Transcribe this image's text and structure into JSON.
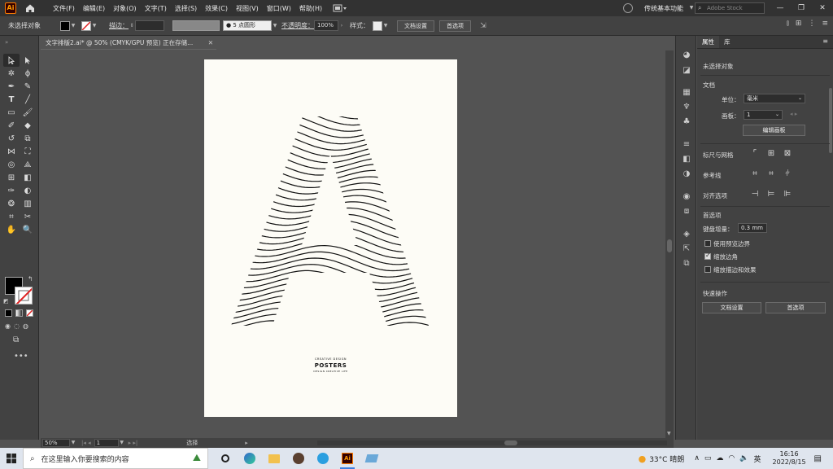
{
  "menubar": {
    "logo": "Ai",
    "items": [
      "文件(F)",
      "编辑(E)",
      "对象(O)",
      "文字(T)",
      "选择(S)",
      "效果(C)",
      "视图(V)",
      "窗口(W)",
      "帮助(H)"
    ],
    "workspace": "传统基本功能",
    "stock_placeholder": "Adobe Stock",
    "window_buttons": [
      "—",
      "❐",
      "✕"
    ]
  },
  "controlbar": {
    "selection_label": "未选择对象",
    "stroke_label": "描边：",
    "brush_value": "5 点圆形",
    "opacity_label": "不透明度：",
    "opacity_value": "100%",
    "style_label": "样式：",
    "doc_setup_button": "文档设置",
    "preferences_button": "首选项"
  },
  "document": {
    "tab_title": "文字排版2.ai* @ 50% (CMYK/GPU 预览) 正在存储...",
    "tab_close": "✕"
  },
  "poster": {
    "line1": "CREATIVE DESIGN",
    "title": "POSTERS",
    "line3": "DESIGN CREATIVE LIFE",
    "letter_fill": "#111111",
    "background": "#fdfcf6"
  },
  "statusbar": {
    "zoom": "50%",
    "page": "1",
    "tool": "选择"
  },
  "properties": {
    "tabs": [
      "属性",
      "库"
    ],
    "no_selection": "未选择对象",
    "document_section": "文档",
    "units_label": "单位：",
    "units_value": "毫米",
    "artboard_label": "画板：",
    "artboard_value": "1",
    "edit_artboards_button": "编辑画板",
    "rulers_grids": "标尺与网格",
    "guides": "参考线",
    "snap_options": "对齐选项",
    "preferences_section": "首选项",
    "keyboard_increment_label": "键盘增量：",
    "keyboard_increment_value": "0.3 mm",
    "use_preview_bounds": "使用预览边界",
    "scale_corners": "缩放边角",
    "scale_strokes_effects": "缩放描边和效果",
    "scale_corners_checked": true,
    "quick_actions": "快速操作",
    "doc_setup_button": "文档设置",
    "preferences_button": "首选项"
  },
  "taskbar": {
    "search_placeholder": "在这里输入你要搜索的内容",
    "weather": "33°C 晴朗",
    "ime": "英",
    "time": "16:16",
    "date": "2022/8/15"
  }
}
